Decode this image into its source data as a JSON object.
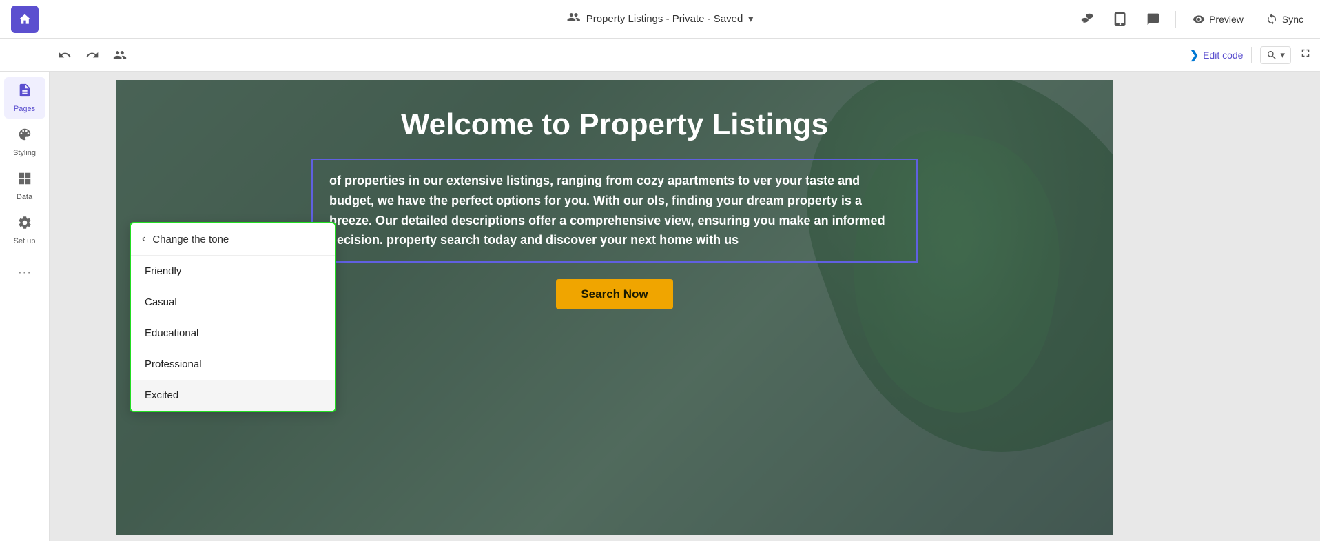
{
  "topbar": {
    "home_icon": "🏠",
    "doc_title": "Property Listings - Private - Saved",
    "chevron_icon": "▾",
    "collab_icon": "👥",
    "tablet_icon": "📱",
    "comment_icon": "💬",
    "preview_label": "Preview",
    "preview_icon": "👁",
    "sync_label": "Sync",
    "sync_icon": "🔄"
  },
  "secondbar": {
    "undo_icon": "↩",
    "redo_icon": "↪",
    "collab2_icon": "👥",
    "edit_code_label": "Edit code",
    "zoom_label": "🔍",
    "zoom_chevron": "▾",
    "expand_icon": "⤢"
  },
  "sidebar": {
    "items": [
      {
        "id": "pages",
        "label": "Pages",
        "icon": "📄",
        "active": true
      },
      {
        "id": "styling",
        "label": "Styling",
        "icon": "🎨",
        "active": false
      },
      {
        "id": "data",
        "label": "Data",
        "icon": "⊞",
        "active": false
      },
      {
        "id": "setup",
        "label": "Set up",
        "icon": "⚙",
        "active": false
      }
    ],
    "more_icon": "···"
  },
  "site": {
    "title": "Welcome to Property Listings",
    "body_text": "of properties in our extensive listings, ranging from cozy apartments to ver your taste and budget, we have the perfect options for you. With our ols, finding your dream property is a breeze. Our detailed descriptions offer a comprehensive view, ensuring you make an informed decision. property search today and discover your next home with us",
    "search_button": "Search Now"
  },
  "tone_panel": {
    "back_label": "Change the tone",
    "items": [
      {
        "id": "friendly",
        "label": "Friendly",
        "highlighted": false
      },
      {
        "id": "casual",
        "label": "Casual",
        "highlighted": false
      },
      {
        "id": "educational",
        "label": "Educational",
        "highlighted": false
      },
      {
        "id": "professional",
        "label": "Professional",
        "highlighted": false
      },
      {
        "id": "excited",
        "label": "Excited",
        "highlighted": true
      }
    ]
  }
}
